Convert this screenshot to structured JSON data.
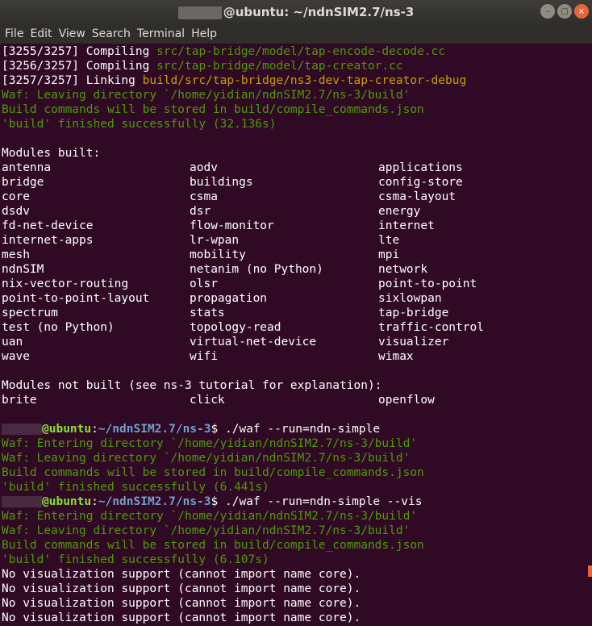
{
  "window": {
    "title": "@ubuntu: ~/ndnSIM2.7/ns-3",
    "buttons": {
      "minimize": "–",
      "maximize": "□",
      "close": "×"
    }
  },
  "menu": [
    "File",
    "Edit",
    "View",
    "Search",
    "Terminal",
    "Help"
  ],
  "lines_top": [
    {
      "prefix": "[3255/3257] Compiling ",
      "path": "src/tap-bridge/model/tap-encode-decode.cc",
      "cls": "green"
    },
    {
      "prefix": "[3256/3257] Compiling ",
      "path": "src/tap-bridge/model/tap-creator.cc",
      "cls": "green"
    },
    {
      "prefix": "[3257/3257] Linking ",
      "path": "build/src/tap-bridge/ns3-dev-tap-creator-debug",
      "cls": "yellow"
    }
  ],
  "waf_block_1": [
    "Waf: Leaving directory `/home/yidian/ndnSIM2.7/ns-3/build'",
    "Build commands will be stored in build/compile_commands.json",
    "'build' finished successfully (32.136s)"
  ],
  "modules_built_header": "Modules built:",
  "modules_built": [
    [
      "antenna",
      "aodv",
      "applications"
    ],
    [
      "bridge",
      "buildings",
      "config-store"
    ],
    [
      "core",
      "csma",
      "csma-layout"
    ],
    [
      "dsdv",
      "dsr",
      "energy"
    ],
    [
      "fd-net-device",
      "flow-monitor",
      "internet"
    ],
    [
      "internet-apps",
      "lr-wpan",
      "lte"
    ],
    [
      "mesh",
      "mobility",
      "mpi"
    ],
    [
      "ndnSIM",
      "netanim (no Python)",
      "network"
    ],
    [
      "nix-vector-routing",
      "olsr",
      "point-to-point"
    ],
    [
      "point-to-point-layout",
      "propagation",
      "sixlowpan"
    ],
    [
      "spectrum",
      "stats",
      "tap-bridge"
    ],
    [
      "test (no Python)",
      "topology-read",
      "traffic-control"
    ],
    [
      "uan",
      "virtual-net-device",
      "visualizer"
    ],
    [
      "wave",
      "wifi",
      "wimax"
    ]
  ],
  "modules_not_built_header": "Modules not built (see ns-3 tutorial for explanation):",
  "modules_not_built": [
    "brite",
    "click",
    "openflow"
  ],
  "prompt": {
    "host": "@ubuntu",
    "colon": ":",
    "path": "~/ndnSIM2.7/ns-3",
    "dollar": "$ "
  },
  "command_1": "./waf --run=ndn-simple",
  "waf_block_2": [
    "Waf: Entering directory `/home/yidian/ndnSIM2.7/ns-3/build'",
    "Waf: Leaving directory `/home/yidian/ndnSIM2.7/ns-3/build'",
    "Build commands will be stored in build/compile_commands.json",
    "'build' finished successfully (6.441s)"
  ],
  "command_2": "./waf --run=ndn-simple --vis",
  "waf_block_3": [
    "Waf: Entering directory `/home/yidian/ndnSIM2.7/ns-3/build'",
    "Waf: Leaving directory `/home/yidian/ndnSIM2.7/ns-3/build'",
    "Build commands will be stored in build/compile_commands.json",
    "'build' finished successfully (6.107s)"
  ],
  "vis_errors": [
    "No visualization support (cannot import name core).",
    "No visualization support (cannot import name core).",
    "No visualization support (cannot import name core).",
    "No visualization support (cannot import name core)."
  ],
  "colors": {
    "background": "#300a24",
    "green": "#4e9a06",
    "yellow": "#c4a000",
    "prompt_user": "#8ae234",
    "prompt_path": "#729fcf"
  }
}
